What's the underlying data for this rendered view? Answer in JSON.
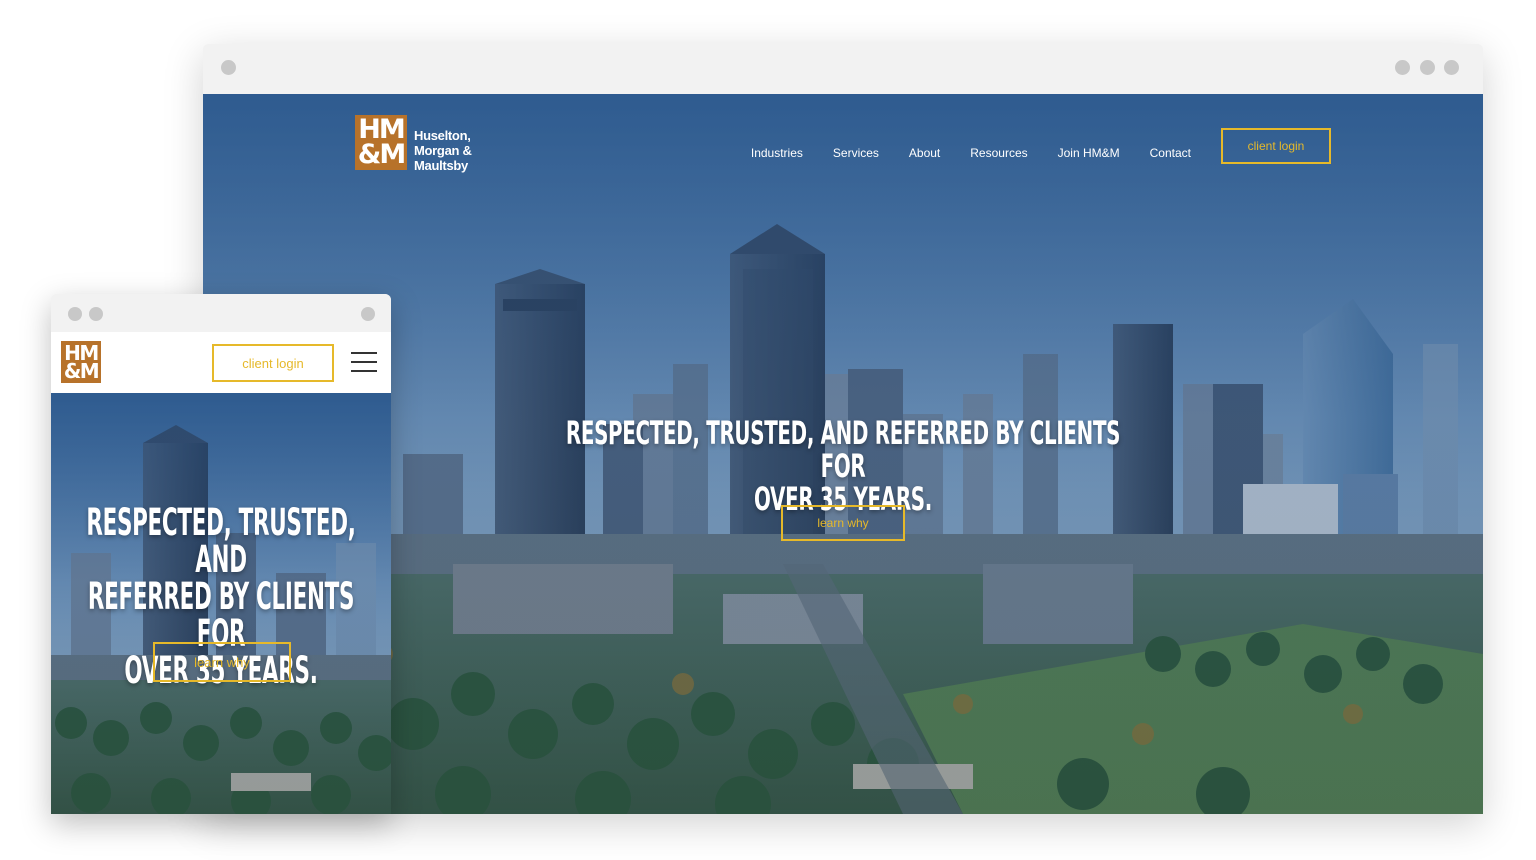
{
  "brand": {
    "monogram_line1": "HM",
    "monogram_line2": "&M",
    "name_line1": "Huselton,",
    "name_line2": "Morgan &",
    "name_line3": "Maultsby",
    "color": "#b7722a"
  },
  "desktop": {
    "nav": {
      "items": [
        {
          "label": "Industries"
        },
        {
          "label": "Services"
        },
        {
          "label": "About"
        },
        {
          "label": "Resources"
        },
        {
          "label": "Join HM&M"
        },
        {
          "label": "Contact"
        }
      ],
      "login_label": "client login"
    },
    "hero": {
      "headline_line1": "RESPECTED, TRUSTED, AND REFERRED BY CLIENTS FOR",
      "headline_line2": "OVER 35 YEARS.",
      "cta_label": "learn why"
    }
  },
  "mobile": {
    "login_label": "client login",
    "menu_icon": "hamburger-icon",
    "hero": {
      "headline_line1": "RESPECTED, TRUSTED, AND",
      "headline_line2": "REFERRED BY CLIENTS FOR",
      "headline_line3": "OVER 35 YEARS.",
      "cta_label": "learn why"
    }
  },
  "colors": {
    "accent": "#e6b92a",
    "overlay": "#23497a",
    "chrome": "#f2f2f2"
  }
}
